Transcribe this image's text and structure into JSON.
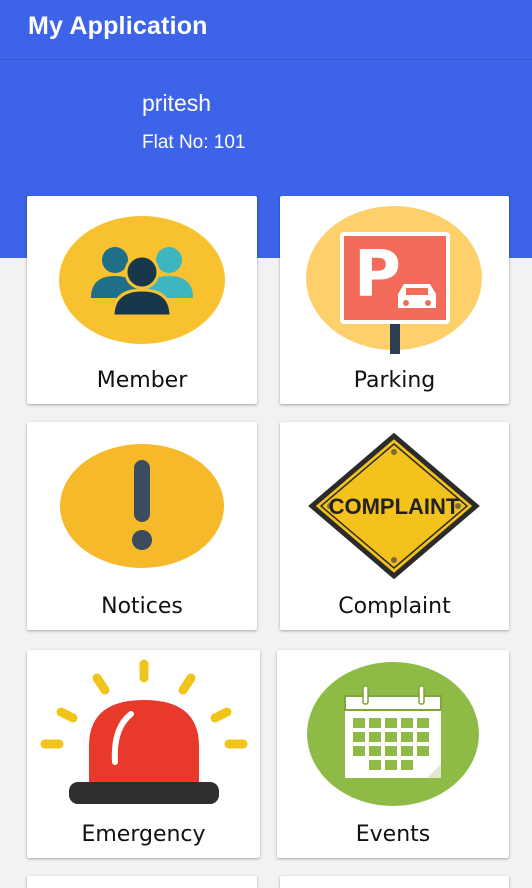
{
  "app_bar": {
    "title": "My Application"
  },
  "profile": {
    "name": "pritesh",
    "flat": "Flat No: 101"
  },
  "colors": {
    "primary": "#3d63e8",
    "icon_yellow": "#f7c12f",
    "parking_red": "#f26b5b",
    "sign_yellow": "#f4c21c",
    "siren_red": "#e8392c",
    "events_green": "#8dbb46"
  },
  "menu": [
    {
      "label": "Member",
      "icon": "members-icon"
    },
    {
      "label": "Parking",
      "icon": "parking-icon"
    },
    {
      "label": "Notices",
      "icon": "notice-icon"
    },
    {
      "label": "Complaint",
      "icon": "complaint-sign-icon",
      "sign_text": "COMPLAINT"
    },
    {
      "label": "Emergency",
      "icon": "emergency-siren-icon"
    },
    {
      "label": "Events",
      "icon": "calendar-icon"
    }
  ]
}
